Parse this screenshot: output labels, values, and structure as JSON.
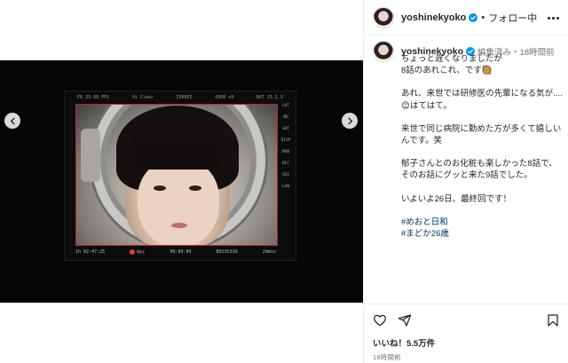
{
  "post": {
    "username": "yoshinekyoko",
    "follow_label": "フォロー中",
    "dot": "•"
  },
  "caption": {
    "username": "yoshinekyoko",
    "meta": "編集済み・18時間前",
    "paragraphs": [
      "ちょっと遅くなりましたが\n8話のあれこれ、です🥘",
      "あれ、来世では研修医の先輩になる気が....😊はてはて。",
      "来世で同じ病院に勤めた方が多くて嬉しいんです。笑",
      "郁子さんとのお化粧も楽しかった8話で、そのお話にグッと来た9話でした。",
      "いよいよ26日、最終回です！"
    ],
    "hashtags": [
      "#めおと日和",
      "#まどか26歳"
    ]
  },
  "monitor": {
    "top_left": "FR 23.98 FPS",
    "top_center": "Hi Clear",
    "top_iso": "2500EI",
    "top_wb": "4300 +0",
    "top_right": "BAT 15.1 V",
    "bottom_left": "1h 02:47:25",
    "bottom_rec": "Rec",
    "bottom_tc": "00:00:00",
    "bottom_clip": "B023C016",
    "bottom_right": "29min",
    "side_labels": [
      "LUT",
      "ND",
      "SHT",
      "DISP",
      "MON",
      "REC",
      "SDI",
      "LAN"
    ]
  },
  "engagement": {
    "likes": "いいね！5.5万件",
    "time": "18時間前"
  },
  "colors": {
    "hashtag": "#00376b",
    "verified": "#0095f6",
    "rec_frame": "#c1272d"
  }
}
